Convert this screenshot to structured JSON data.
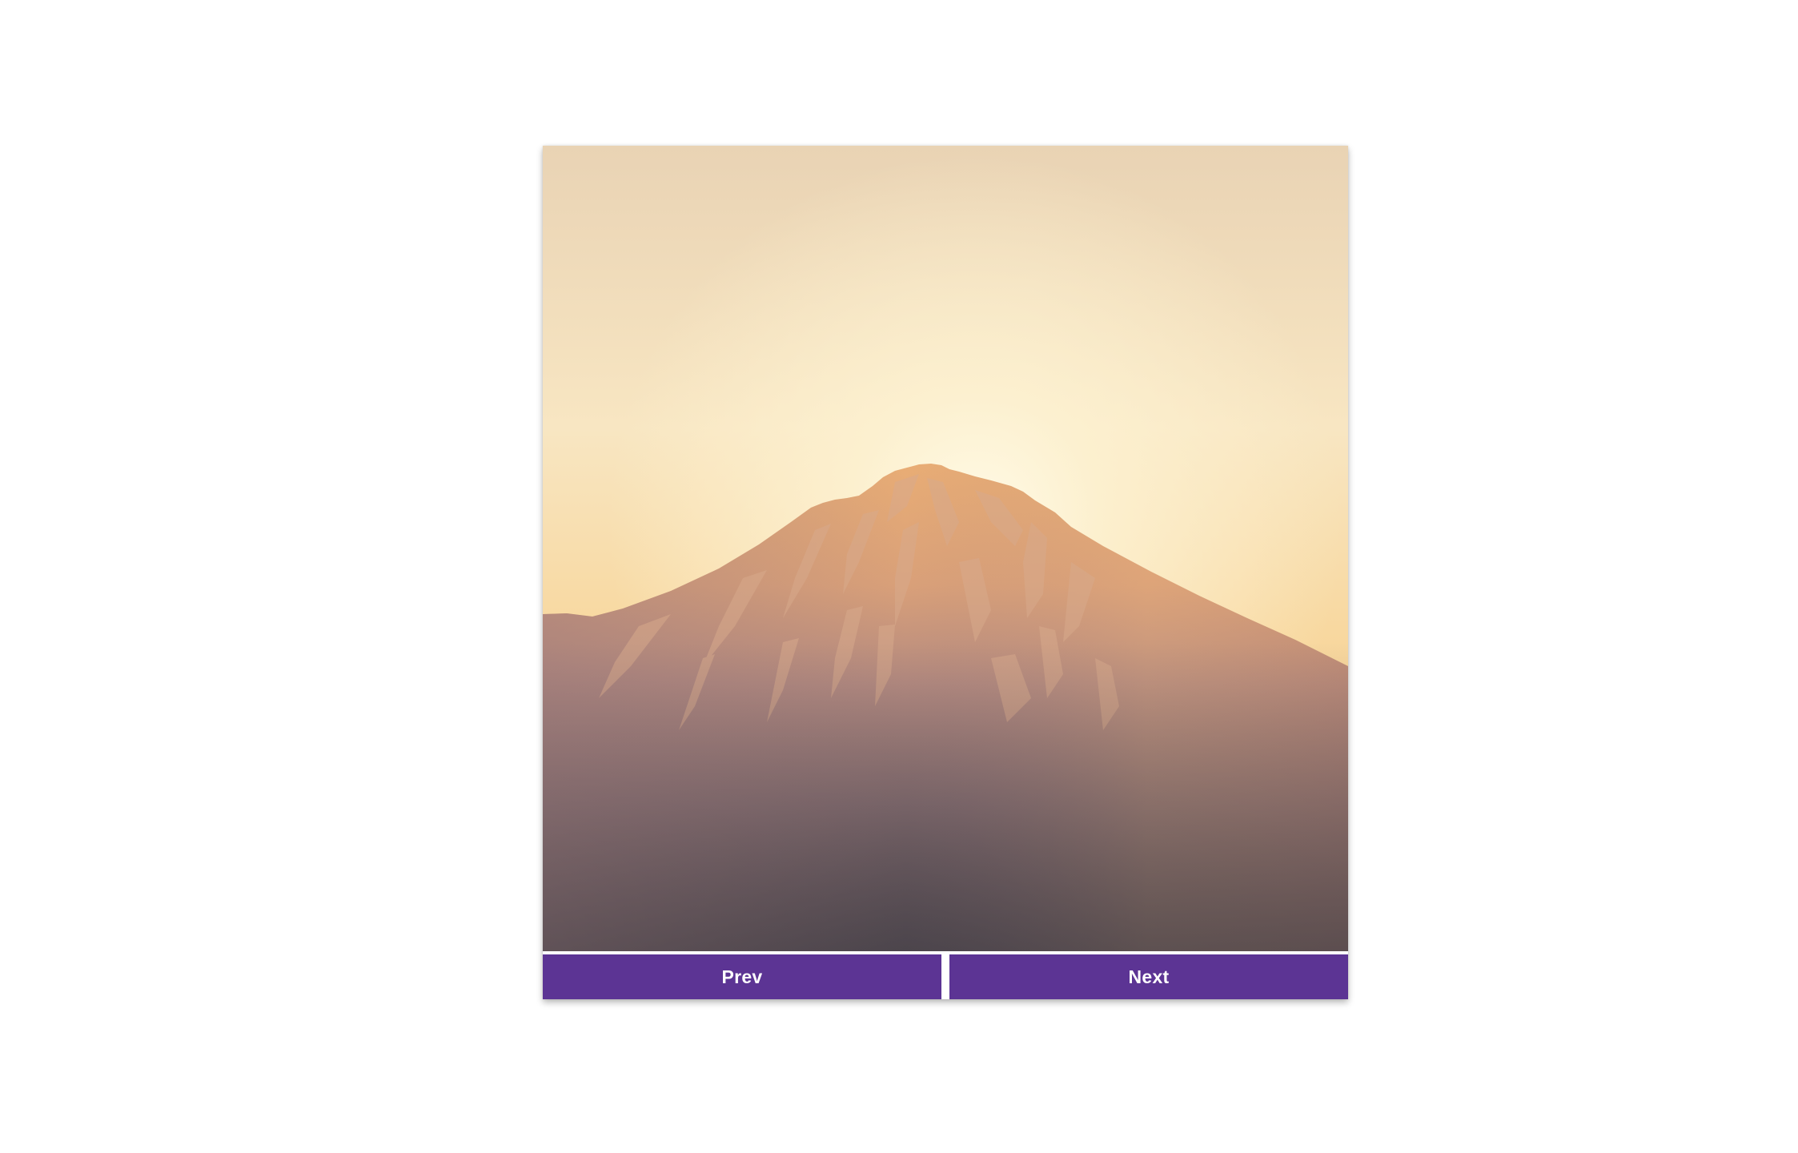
{
  "carousel": {
    "image": {
      "subject": "mountain-at-sunset",
      "colors": {
        "sky_top": "#ecd8b8",
        "sky_glow": "#fdf3d4",
        "sky_horizon": "#f7cf8a",
        "mountain_light": "#e8ab72",
        "mountain_mid": "#a9837c",
        "mountain_base": "#4c454c",
        "snow": "#c99a86"
      }
    },
    "buttons": {
      "prev_label": "Prev",
      "next_label": "Next",
      "color": "#5c3494",
      "text_color": "#ffffff"
    }
  }
}
